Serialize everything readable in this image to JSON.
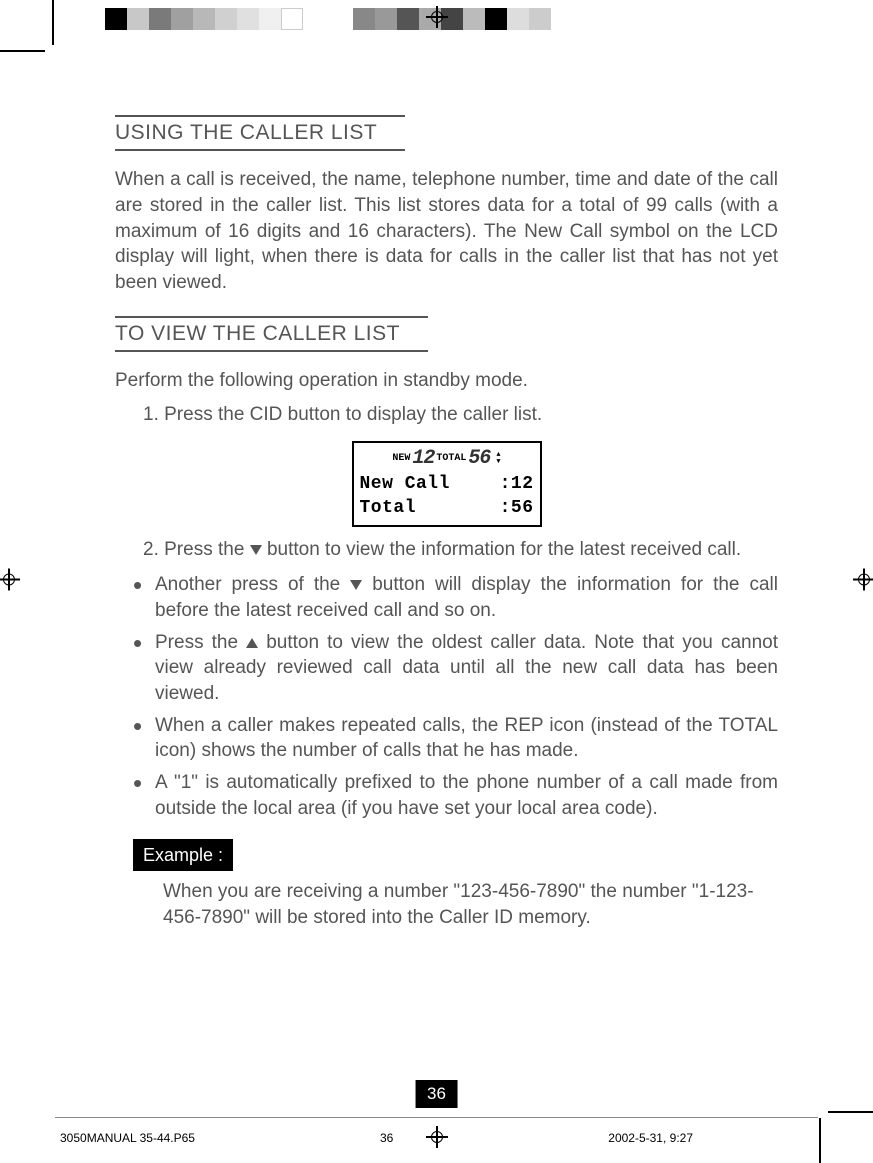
{
  "headings": {
    "h1": "USING THE CALLER LIST",
    "h2": "TO VIEW THE CALLER LIST"
  },
  "paragraphs": {
    "p1": "When a call is received, the name, telephone number, time and date of the call are stored in the caller list. This list stores data for a total of 99 calls (with a maximum of 16 digits and 16 characters). The New Call symbol on the LCD display will light, when there is data for calls in the caller list that has not yet been viewed.",
    "p2": "Perform the following operation in standby mode."
  },
  "steps": {
    "s1": "1. Press the CID button to display the caller list.",
    "s2a": "2. Press the ",
    "s2b": " button to view the information for the latest received call."
  },
  "lcd": {
    "new_label": "NEW",
    "new_value": "12",
    "total_label": "TOTAL",
    "total_value": "56",
    "row1_left": "New Call",
    "row1_right": ":12",
    "row2_left": "Total",
    "row2_right": ":56"
  },
  "bullets": {
    "b1a": "Another press of the ",
    "b1b": " button will display the information for the call before the latest received call and so on.",
    "b2a": "Press the ",
    "b2b": " button to view the oldest caller data. Note that you cannot view already reviewed call data until all the new call data has been viewed.",
    "b3": "When a caller makes repeated calls, the REP icon (instead of the TOTAL icon) shows the number of calls that he has made.",
    "b4": "A \"1\" is automatically prefixed to the phone number of a call made from outside the local area (if you have set your local area code)."
  },
  "example": {
    "label": "Example :",
    "text": "When you are receiving a number \"123-456-7890\" the number \"1-123-456-7890\" will be stored into the Caller ID memory."
  },
  "page_number": "36",
  "footer": {
    "filename": "3050MANUAL 35-44.P65",
    "page": "36",
    "datetime": "2002-5-31, 9:27"
  }
}
